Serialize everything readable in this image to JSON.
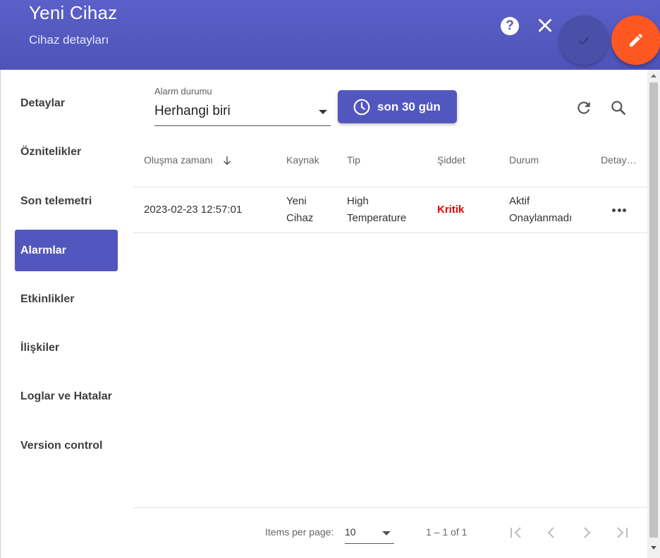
{
  "header": {
    "title": "Yeni Cihaz",
    "subtitle": "Cihaz detayları",
    "help_icon": "question-circle-icon",
    "close_icon": "close-icon",
    "confirm_icon": "check-icon",
    "edit_icon": "pencil-icon"
  },
  "sidebar": {
    "items": [
      {
        "label": "Detaylar"
      },
      {
        "label": "Öznitelikler"
      },
      {
        "label": "Son telemetri"
      },
      {
        "label": "Alarmlar",
        "active": true
      },
      {
        "label": "Etkinlikler"
      },
      {
        "label": "İlişkiler"
      },
      {
        "label": "Loglar ve Hatalar"
      },
      {
        "label": "Version control"
      }
    ]
  },
  "toolbar": {
    "filter_label": "Alarm durumu",
    "filter_value": "Herhangi biri",
    "time_button_label": "son 30 gün",
    "time_icon": "clock-icon",
    "refresh_icon": "refresh-icon",
    "search_icon": "search-icon"
  },
  "table": {
    "headers": [
      "Oluşma zamanı",
      "Kaynak",
      "Tip",
      "Şiddet",
      "Durum",
      "Detay…"
    ],
    "sort_icon": "arrow-down-icon",
    "rows": [
      {
        "created": "2023-02-23 12:57:01",
        "source": [
          "Yeni",
          "Cihaz"
        ],
        "type": [
          "High",
          "Temperature"
        ],
        "severity": "Kritik",
        "status": [
          "Aktif",
          "Onaylanmadı"
        ],
        "details_icon": "more-horiz-icon"
      }
    ]
  },
  "paginator": {
    "items_per_page_label": "Items per page:",
    "page_size": "10",
    "range": "1 – 1 of 1",
    "first_icon": "first-page-icon",
    "prev_icon": "chevron-left-icon",
    "next_icon": "chevron-right-icon",
    "last_icon": "last-page-icon"
  },
  "colors": {
    "primary": "#5257bf",
    "accent": "#ff5722",
    "severity_critical": "#e00000"
  }
}
